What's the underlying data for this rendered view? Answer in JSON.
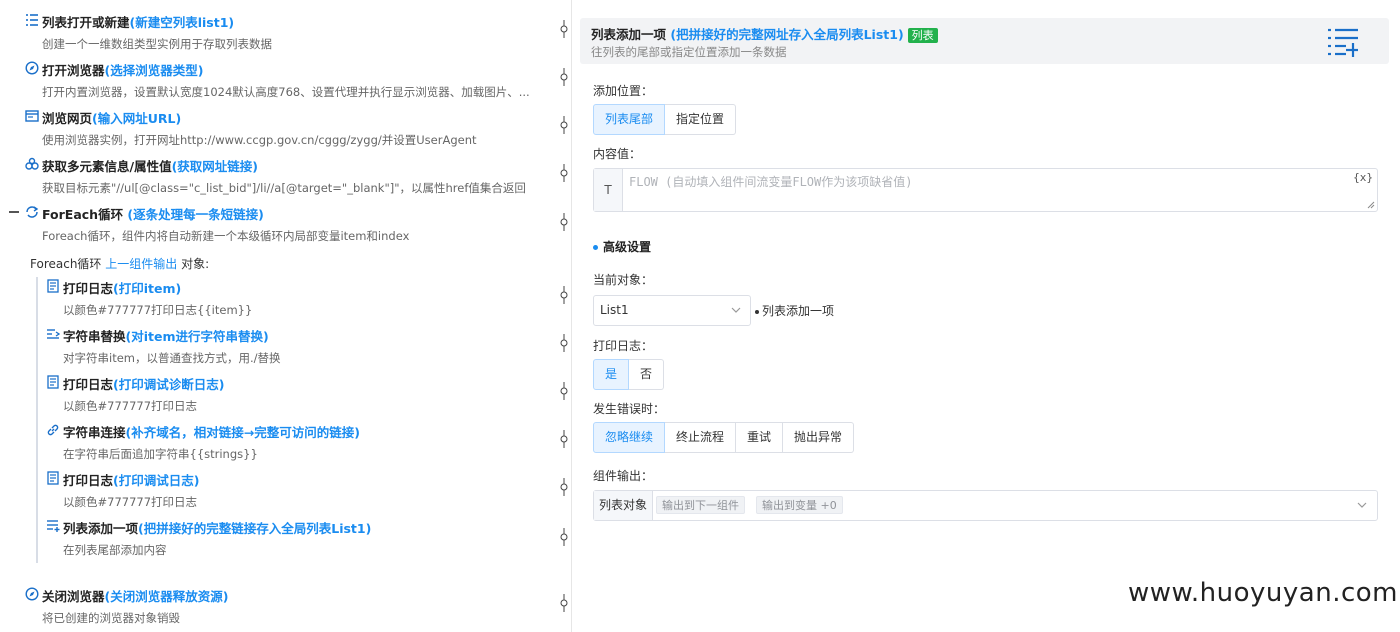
{
  "flow": {
    "steps": [
      {
        "title": "列表打开或新建",
        "param": "(新建空列表list1)",
        "desc": "创建一个一维数组类型实例用于存取列表数据",
        "icon": "list-icon"
      },
      {
        "title": "打开浏览器",
        "param": "(选择浏览器类型)",
        "desc": "打开内置浏览器，设置默认宽度1024默认高度768、设置代理并执行显示浏览器、加载图片、...",
        "icon": "compass-icon"
      },
      {
        "title": "浏览网页",
        "param": "(输入网址URL)",
        "desc": "使用浏览器实例，打开网址http://www.ccgp.gov.cn/cggg/zygg/并设置UserAgent",
        "icon": "browser-window-icon"
      },
      {
        "title": "获取多元素信息/属性值",
        "param": "(获取网址链接)",
        "desc": "获取目标元素\"//ul[@class=\"c_list_bid\"]/li//a[@target=\"_blank\"]\"，以属性href值集合返回",
        "icon": "elements-icon"
      },
      {
        "title": "ForEach循环",
        "param": " (逐条处理每一条短链接)",
        "desc": "Foreach循环，组件内将自动新建一个本级循环内局部变量item和index",
        "icon": "loop-icon"
      },
      {
        "title": "打印日志",
        "param": "(打印item)",
        "desc": "以颜色#777777打印日志{{item}}",
        "icon": "log-icon"
      },
      {
        "title": "字符串替换",
        "param": "(对item进行字符串替换)",
        "desc": "对字符串item，以普通查找方式，用./替换",
        "icon": "replace-icon"
      },
      {
        "title": "打印日志",
        "param": "(打印调试诊断日志)",
        "desc": "以颜色#777777打印日志",
        "icon": "log-icon"
      },
      {
        "title": "字符串连接",
        "param": "(补齐域名，相对链接→完整可访问的链接)",
        "desc": "在字符串后面追加字符串{{strings}}",
        "icon": "link-icon"
      },
      {
        "title": "打印日志",
        "param": "(打印调试日志)",
        "desc": "以颜色#777777打印日志",
        "icon": "log-icon"
      },
      {
        "title": "列表添加一项",
        "param": "(把拼接好的完整链接存入全局列表List1)",
        "desc": "在列表尾部添加内容",
        "icon": "list-add-icon"
      },
      {
        "title": "关闭浏览器",
        "param": "(关闭浏览器释放资源)",
        "desc": "将已创建的浏览器对象销毁",
        "icon": "close-browser-icon"
      }
    ],
    "foreach_object": {
      "prefix": "Foreach循环 ",
      "link": "上一组件输出",
      "suffix": " 对象:"
    },
    "collapse_symbol": "—"
  },
  "panel": {
    "title": "列表添加一项",
    "param": " (把拼接好的完整网址存入全局列表List1)",
    "badge": "列表",
    "desc": "往列表的尾部或指定位置添加一条数据",
    "position_label": "添加位置：",
    "position_options": [
      "列表尾部",
      "指定位置"
    ],
    "content_label": "内容值：",
    "content_prefix": "T",
    "content_placeholder": "FLOW (自动填入组件间流变量FLOW作为该项缺省值)",
    "var_icon": "{x}",
    "advanced_label": "高级设置",
    "target_label": "当前对象：",
    "target_value": "List1",
    "target_tag": "列表添加一项",
    "log_label": "打印日志：",
    "log_options": [
      "是",
      "否"
    ],
    "error_label": "发生错误时：",
    "error_options": [
      "忽略继续",
      "终止流程",
      "重试",
      "抛出异常"
    ],
    "output_label": "组件输出：",
    "output_prefix": "列表对象",
    "output_tags": [
      "输出到下一组件",
      "输出到变量 +0"
    ]
  },
  "watermark": "www.huoyuyan.com",
  "colors": {
    "accent": "#1a8cf0",
    "badge": "#22b14c",
    "active_bg": "#e8f3ff"
  }
}
